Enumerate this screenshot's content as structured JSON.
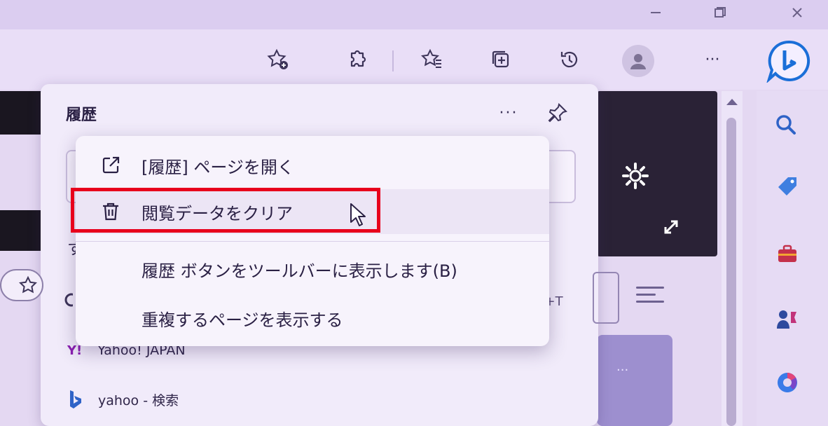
{
  "colors": {
    "accent": "#1b6fd8",
    "highlight": "#e8001c",
    "panel_bg": "#f1ebfa",
    "menu_bg": "#f7f3fc"
  },
  "window_controls": [
    "minimize-icon",
    "restore-icon",
    "close-icon"
  ],
  "toolbar": {
    "more_label": "···",
    "icons": [
      "favorite-add-icon",
      "extensions-icon",
      "favorites-icon",
      "collections-icon",
      "history-icon",
      "profile-avatar",
      "bing-copilot-icon"
    ]
  },
  "history_panel": {
    "title": "履歴",
    "more_label": "···",
    "partial_label": "す",
    "shortcut_fragment": "hift+T",
    "items": [
      {
        "icon": "yahoo-japan-icon",
        "icon_text": "Y!",
        "title": "Yahoo! JAPAN"
      },
      {
        "icon": "bing-icon",
        "title": "yahoo - 検索"
      }
    ],
    "tile_more": "···"
  },
  "context_menu": {
    "items": [
      {
        "label": "[履歴] ページを開く",
        "icon": "open-external-icon"
      },
      {
        "label": "閲覧データをクリア",
        "icon": "trash-icon",
        "highlighted": true
      },
      {
        "label": "履歴 ボタンをツールバーに表示します(B)"
      },
      {
        "label": "重複するページを表示する"
      }
    ]
  },
  "sidebar": {
    "icons": [
      "search-icon",
      "shopping-tag-icon",
      "tools-icon",
      "games-icon",
      "office-icon"
    ]
  }
}
